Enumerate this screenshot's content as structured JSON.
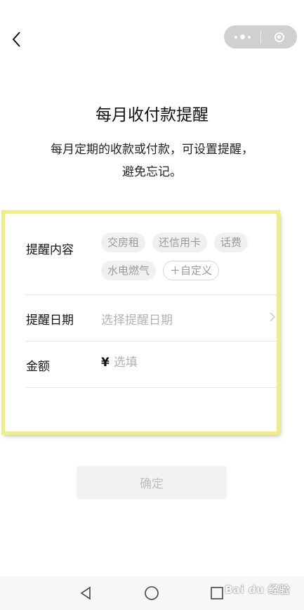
{
  "nav": {
    "back_icon": "chevron-left-icon"
  },
  "capsule": {
    "more_icon": "more-dots-icon",
    "close_icon": "target-circle-icon"
  },
  "header": {
    "title": "每月收付款提醒",
    "subtitle_line1": "每月定期的收款或付款，可设置提醒，",
    "subtitle_line2": "避免忘记。"
  },
  "form": {
    "content_label": "提醒内容",
    "tags": [
      "交房租",
      "还信用卡",
      "话费",
      "水电燃气"
    ],
    "custom_tag": "＋自定义",
    "date_label": "提醒日期",
    "date_placeholder": "选择提醒日期",
    "amount_label": "金额",
    "currency": "¥",
    "amount_placeholder": "选填"
  },
  "confirm_label": "确定",
  "watermark": "Bai du 经验",
  "colors": {
    "highlight_border": "#f3ef6f",
    "disabled_button": "#f2f2f2",
    "placeholder": "#b3b3b3"
  }
}
